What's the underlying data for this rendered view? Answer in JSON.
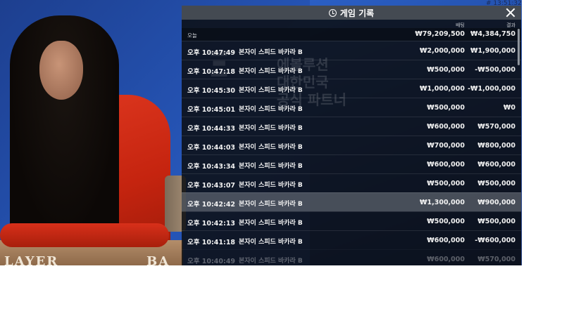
{
  "clock": "# 13:51:32",
  "panel": {
    "title": "게임 기록",
    "columns": {
      "bet": "배팅",
      "result": "결과"
    },
    "summary": {
      "label": "오늘",
      "total_bet": "₩79,209,500",
      "total_result": "₩4,384,750"
    },
    "watermark": [
      "에볼루션",
      "대한민국",
      "공식 파트너"
    ],
    "rows": [
      {
        "time": "오후 10:47:49",
        "game": "본자이 스피드 바카라 B",
        "bet": "₩2,000,000",
        "result": "₩1,900,000"
      },
      {
        "time": "오후 10:47:18",
        "game": "본자이 스피드 바카라 B",
        "bet": "₩500,000",
        "result": "-₩500,000"
      },
      {
        "time": "오후 10:45:30",
        "game": "본자이 스피드 바카라 B",
        "bet": "₩1,000,000",
        "result": "-₩1,000,000"
      },
      {
        "time": "오후 10:45:01",
        "game": "본자이 스피드 바카라 B",
        "bet": "₩500,000",
        "result": "₩0"
      },
      {
        "time": "오후 10:44:33",
        "game": "본자이 스피드 바카라 B",
        "bet": "₩600,000",
        "result": "₩570,000"
      },
      {
        "time": "오후 10:44:03",
        "game": "본자이 스피드 바카라 B",
        "bet": "₩700,000",
        "result": "₩800,000"
      },
      {
        "time": "오후 10:43:34",
        "game": "본자이 스피드 바카라 B",
        "bet": "₩600,000",
        "result": "₩600,000"
      },
      {
        "time": "오후 10:43:07",
        "game": "본자이 스피드 바카라 B",
        "bet": "₩500,000",
        "result": "₩500,000"
      },
      {
        "time": "오후 10:42:42",
        "game": "본자이 스피드 바카라 B",
        "bet": "₩1,300,000",
        "result": "₩900,000"
      },
      {
        "time": "오후 10:42:13",
        "game": "본자이 스피드 바카라 B",
        "bet": "₩500,000",
        "result": "₩500,000"
      },
      {
        "time": "오후 10:41:18",
        "game": "본자이 스피드 바카라 B",
        "bet": "₩600,000",
        "result": "-₩600,000"
      },
      {
        "time": "오후 10:40:49",
        "game": "본자이 스피드 바카라 B",
        "bet": "₩600,000",
        "result": "₩570,000"
      }
    ]
  },
  "table_labels": {
    "left": "LAYER",
    "right": "BA"
  }
}
